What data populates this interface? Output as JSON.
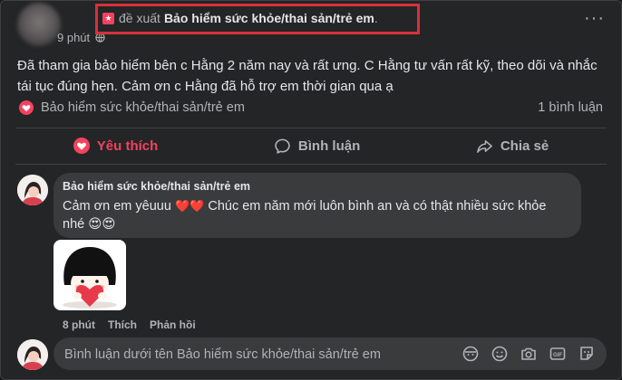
{
  "post": {
    "time": "9 phút",
    "recommend_prefix": "đề xuất",
    "page_name": "Bảo hiểm sức khỏe/thai sản/trẻ em",
    "period": ".",
    "text": "Đã tham gia bảo hiểm bên c Hằng 2 năm nay và rất ưng. C Hằng tư vấn rất kỹ, theo dõi và nhắc tái tục đúng hẹn. Cảm ơn c Hằng đã hỗ trợ em thời gian qua ạ",
    "recommendation_line": "Bảo hiểm sức khỏe/thai sản/trẻ em",
    "comment_count": "1 bình luận"
  },
  "actions": {
    "like": "Yêu thích",
    "comment": "Bình luận",
    "share": "Chia sẻ"
  },
  "comment": {
    "author": "Bảo hiểm sức khỏe/thai sản/trẻ em",
    "text_part1": "Cảm ơn em yêuuu ",
    "text_part2": " Chúc em năm mới luôn bình an và có thật nhiều sức khỏe nhé ",
    "time": "8 phút",
    "like": "Thích",
    "reply": "Phản hồi"
  },
  "composer": {
    "placeholder": "Bình luận dưới tên Bảo hiểm sức khỏe/thai sản/trẻ em"
  },
  "icons": {
    "globe": "globe-icon",
    "heart": "heart-icon",
    "more": "more-icon",
    "comment": "comment-icon",
    "share": "share-icon"
  },
  "colors": {
    "background": "#242526",
    "bubble": "#3a3b3c",
    "accent_like": "#f3425f",
    "highlight_box": "#d8303b"
  }
}
